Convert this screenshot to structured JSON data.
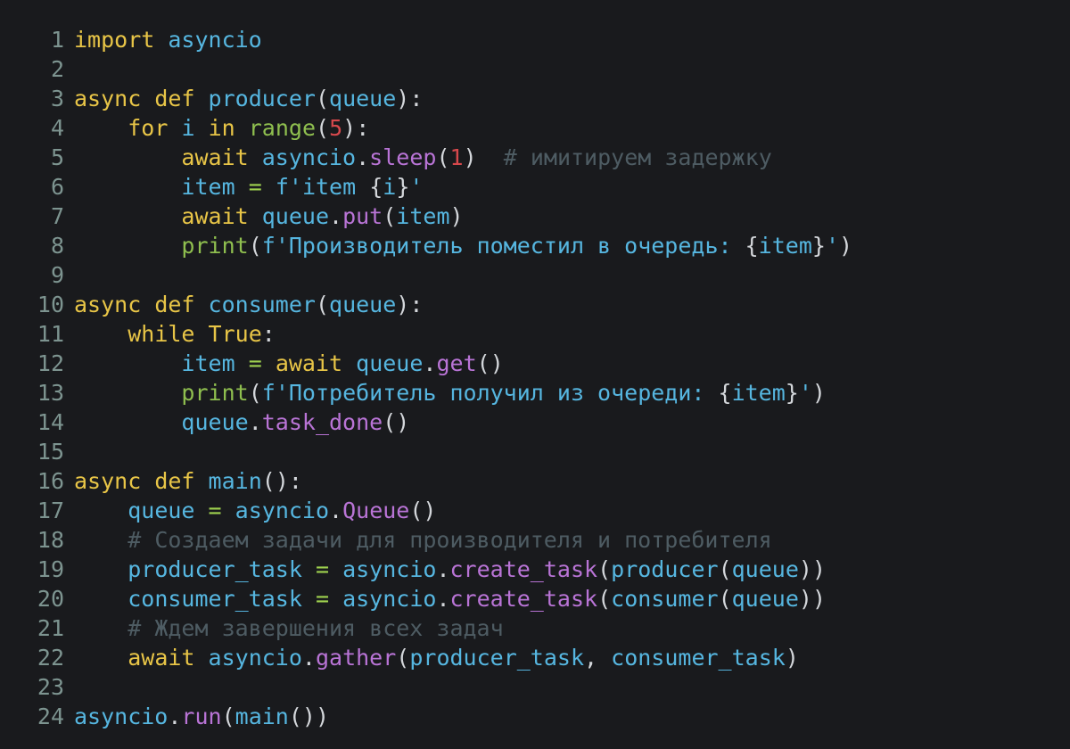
{
  "editor": {
    "language": "Python",
    "background_color": "#191a1d",
    "line_number_color": "#7d9490",
    "total_lines": 24,
    "theme_colors": {
      "keyword": "#e8c547",
      "builtin": "#8fbf4f",
      "number": "#d6484c",
      "name": "#56b6e0",
      "method": "#b974d6",
      "string": "#56b6e0",
      "comment": "#4e5c63",
      "operator": "#9fd14f",
      "punctuation": "#d4d7db"
    }
  },
  "lines": [
    {
      "number": "1",
      "text": "import asyncio",
      "tokens": [
        {
          "t": "import",
          "c": "keyword"
        },
        {
          "t": " ",
          "c": "plain"
        },
        {
          "t": "asyncio",
          "c": "name"
        }
      ]
    },
    {
      "number": "2",
      "text": "",
      "tokens": []
    },
    {
      "number": "3",
      "text": "async def producer(queue):",
      "tokens": [
        {
          "t": "async",
          "c": "keyword"
        },
        {
          "t": " ",
          "c": "plain"
        },
        {
          "t": "def",
          "c": "keyword"
        },
        {
          "t": " ",
          "c": "plain"
        },
        {
          "t": "producer",
          "c": "name"
        },
        {
          "t": "(",
          "c": "punct"
        },
        {
          "t": "queue",
          "c": "name"
        },
        {
          "t": ")",
          "c": "punct"
        },
        {
          "t": ":",
          "c": "punct"
        }
      ]
    },
    {
      "number": "4",
      "text": "    for i in range(5):",
      "tokens": [
        {
          "t": "    ",
          "c": "plain"
        },
        {
          "t": "for",
          "c": "keyword"
        },
        {
          "t": " ",
          "c": "plain"
        },
        {
          "t": "i",
          "c": "name"
        },
        {
          "t": " ",
          "c": "plain"
        },
        {
          "t": "in",
          "c": "keyword"
        },
        {
          "t": " ",
          "c": "plain"
        },
        {
          "t": "range",
          "c": "builtin"
        },
        {
          "t": "(",
          "c": "punct"
        },
        {
          "t": "5",
          "c": "number"
        },
        {
          "t": ")",
          "c": "punct"
        },
        {
          "t": ":",
          "c": "punct"
        }
      ]
    },
    {
      "number": "5",
      "text": "        await asyncio.sleep(1)  # имитируем задержку",
      "tokens": [
        {
          "t": "        ",
          "c": "plain"
        },
        {
          "t": "await",
          "c": "keyword"
        },
        {
          "t": " ",
          "c": "plain"
        },
        {
          "t": "asyncio",
          "c": "name"
        },
        {
          "t": ".",
          "c": "punct"
        },
        {
          "t": "sleep",
          "c": "method"
        },
        {
          "t": "(",
          "c": "punct"
        },
        {
          "t": "1",
          "c": "number"
        },
        {
          "t": ")",
          "c": "punct"
        },
        {
          "t": "  ",
          "c": "plain"
        },
        {
          "t": "# имитируем задержку",
          "c": "comment"
        }
      ]
    },
    {
      "number": "6",
      "text": "        item = f'item {i}'",
      "tokens": [
        {
          "t": "        ",
          "c": "plain"
        },
        {
          "t": "item",
          "c": "name"
        },
        {
          "t": " ",
          "c": "plain"
        },
        {
          "t": "=",
          "c": "operator"
        },
        {
          "t": " ",
          "c": "plain"
        },
        {
          "t": "f",
          "c": "fprefix"
        },
        {
          "t": "'item ",
          "c": "string"
        },
        {
          "t": "{",
          "c": "interp"
        },
        {
          "t": "i",
          "c": "string"
        },
        {
          "t": "}",
          "c": "interp"
        },
        {
          "t": "'",
          "c": "string"
        }
      ]
    },
    {
      "number": "7",
      "text": "        await queue.put(item)",
      "tokens": [
        {
          "t": "        ",
          "c": "plain"
        },
        {
          "t": "await",
          "c": "keyword"
        },
        {
          "t": " ",
          "c": "plain"
        },
        {
          "t": "queue",
          "c": "name"
        },
        {
          "t": ".",
          "c": "punct"
        },
        {
          "t": "put",
          "c": "method"
        },
        {
          "t": "(",
          "c": "punct"
        },
        {
          "t": "item",
          "c": "name"
        },
        {
          "t": ")",
          "c": "punct"
        }
      ]
    },
    {
      "number": "8",
      "text": "        print(f'Производитель поместил в очередь: {item}')",
      "tokens": [
        {
          "t": "        ",
          "c": "plain"
        },
        {
          "t": "print",
          "c": "builtin"
        },
        {
          "t": "(",
          "c": "punct"
        },
        {
          "t": "f",
          "c": "fprefix"
        },
        {
          "t": "'Производитель поместил в очередь: ",
          "c": "string"
        },
        {
          "t": "{",
          "c": "interp"
        },
        {
          "t": "item",
          "c": "string"
        },
        {
          "t": "}",
          "c": "interp"
        },
        {
          "t": "'",
          "c": "string"
        },
        {
          "t": ")",
          "c": "punct"
        }
      ]
    },
    {
      "number": "9",
      "text": "",
      "tokens": []
    },
    {
      "number": "10",
      "text": "async def consumer(queue):",
      "tokens": [
        {
          "t": "async",
          "c": "keyword"
        },
        {
          "t": " ",
          "c": "plain"
        },
        {
          "t": "def",
          "c": "keyword"
        },
        {
          "t": " ",
          "c": "plain"
        },
        {
          "t": "consumer",
          "c": "name"
        },
        {
          "t": "(",
          "c": "punct"
        },
        {
          "t": "queue",
          "c": "name"
        },
        {
          "t": ")",
          "c": "punct"
        },
        {
          "t": ":",
          "c": "punct"
        }
      ]
    },
    {
      "number": "11",
      "text": "    while True:",
      "tokens": [
        {
          "t": "    ",
          "c": "plain"
        },
        {
          "t": "while",
          "c": "keyword"
        },
        {
          "t": " ",
          "c": "plain"
        },
        {
          "t": "True",
          "c": "keyword"
        },
        {
          "t": ":",
          "c": "punct"
        }
      ]
    },
    {
      "number": "12",
      "text": "        item = await queue.get()",
      "tokens": [
        {
          "t": "        ",
          "c": "plain"
        },
        {
          "t": "item",
          "c": "name"
        },
        {
          "t": " ",
          "c": "plain"
        },
        {
          "t": "=",
          "c": "operator"
        },
        {
          "t": " ",
          "c": "plain"
        },
        {
          "t": "await",
          "c": "keyword"
        },
        {
          "t": " ",
          "c": "plain"
        },
        {
          "t": "queue",
          "c": "name"
        },
        {
          "t": ".",
          "c": "punct"
        },
        {
          "t": "get",
          "c": "method"
        },
        {
          "t": "()",
          "c": "punct"
        }
      ]
    },
    {
      "number": "13",
      "text": "        print(f'Потребитель получил из очереди: {item}')",
      "tokens": [
        {
          "t": "        ",
          "c": "plain"
        },
        {
          "t": "print",
          "c": "builtin"
        },
        {
          "t": "(",
          "c": "punct"
        },
        {
          "t": "f",
          "c": "fprefix"
        },
        {
          "t": "'Потребитель получил из очереди: ",
          "c": "string"
        },
        {
          "t": "{",
          "c": "interp"
        },
        {
          "t": "item",
          "c": "string"
        },
        {
          "t": "}",
          "c": "interp"
        },
        {
          "t": "'",
          "c": "string"
        },
        {
          "t": ")",
          "c": "punct"
        }
      ]
    },
    {
      "number": "14",
      "text": "        queue.task_done()",
      "tokens": [
        {
          "t": "        ",
          "c": "plain"
        },
        {
          "t": "queue",
          "c": "name"
        },
        {
          "t": ".",
          "c": "punct"
        },
        {
          "t": "task_done",
          "c": "method"
        },
        {
          "t": "()",
          "c": "punct"
        }
      ]
    },
    {
      "number": "15",
      "text": "",
      "tokens": []
    },
    {
      "number": "16",
      "text": "async def main():",
      "tokens": [
        {
          "t": "async",
          "c": "keyword"
        },
        {
          "t": " ",
          "c": "plain"
        },
        {
          "t": "def",
          "c": "keyword"
        },
        {
          "t": " ",
          "c": "plain"
        },
        {
          "t": "main",
          "c": "name"
        },
        {
          "t": "()",
          "c": "punct"
        },
        {
          "t": ":",
          "c": "punct"
        }
      ]
    },
    {
      "number": "17",
      "text": "    queue = asyncio.Queue()",
      "tokens": [
        {
          "t": "    ",
          "c": "plain"
        },
        {
          "t": "queue",
          "c": "name"
        },
        {
          "t": " ",
          "c": "plain"
        },
        {
          "t": "=",
          "c": "operator"
        },
        {
          "t": " ",
          "c": "plain"
        },
        {
          "t": "asyncio",
          "c": "name"
        },
        {
          "t": ".",
          "c": "punct"
        },
        {
          "t": "Queue",
          "c": "method"
        },
        {
          "t": "()",
          "c": "punct"
        }
      ]
    },
    {
      "number": "18",
      "text": "    # Создаем задачи для производителя и потребителя",
      "tokens": [
        {
          "t": "    ",
          "c": "plain"
        },
        {
          "t": "# Создаем задачи для производителя и потребителя",
          "c": "comment"
        }
      ]
    },
    {
      "number": "19",
      "text": "    producer_task = asyncio.create_task(producer(queue))",
      "tokens": [
        {
          "t": "    ",
          "c": "plain"
        },
        {
          "t": "producer_task",
          "c": "name"
        },
        {
          "t": " ",
          "c": "plain"
        },
        {
          "t": "=",
          "c": "operator"
        },
        {
          "t": " ",
          "c": "plain"
        },
        {
          "t": "asyncio",
          "c": "name"
        },
        {
          "t": ".",
          "c": "punct"
        },
        {
          "t": "create_task",
          "c": "method"
        },
        {
          "t": "(",
          "c": "punct"
        },
        {
          "t": "producer",
          "c": "name"
        },
        {
          "t": "(",
          "c": "punct"
        },
        {
          "t": "queue",
          "c": "name"
        },
        {
          "t": "))",
          "c": "punct"
        }
      ]
    },
    {
      "number": "20",
      "text": "    consumer_task = asyncio.create_task(consumer(queue))",
      "tokens": [
        {
          "t": "    ",
          "c": "plain"
        },
        {
          "t": "consumer_task",
          "c": "name"
        },
        {
          "t": " ",
          "c": "plain"
        },
        {
          "t": "=",
          "c": "operator"
        },
        {
          "t": " ",
          "c": "plain"
        },
        {
          "t": "asyncio",
          "c": "name"
        },
        {
          "t": ".",
          "c": "punct"
        },
        {
          "t": "create_task",
          "c": "method"
        },
        {
          "t": "(",
          "c": "punct"
        },
        {
          "t": "consumer",
          "c": "name"
        },
        {
          "t": "(",
          "c": "punct"
        },
        {
          "t": "queue",
          "c": "name"
        },
        {
          "t": "))",
          "c": "punct"
        }
      ]
    },
    {
      "number": "21",
      "text": "    # Ждем завершения всех задач",
      "tokens": [
        {
          "t": "    ",
          "c": "plain"
        },
        {
          "t": "# Ждем завершения всех задач",
          "c": "comment"
        }
      ]
    },
    {
      "number": "22",
      "text": "    await asyncio.gather(producer_task, consumer_task)",
      "tokens": [
        {
          "t": "    ",
          "c": "plain"
        },
        {
          "t": "await",
          "c": "keyword"
        },
        {
          "t": " ",
          "c": "plain"
        },
        {
          "t": "asyncio",
          "c": "name"
        },
        {
          "t": ".",
          "c": "punct"
        },
        {
          "t": "gather",
          "c": "method"
        },
        {
          "t": "(",
          "c": "punct"
        },
        {
          "t": "producer_task",
          "c": "name"
        },
        {
          "t": ",",
          "c": "punct"
        },
        {
          "t": " ",
          "c": "plain"
        },
        {
          "t": "consumer_task",
          "c": "name"
        },
        {
          "t": ")",
          "c": "punct"
        }
      ]
    },
    {
      "number": "23",
      "text": "",
      "tokens": []
    },
    {
      "number": "24",
      "text": "asyncio.run(main())",
      "tokens": [
        {
          "t": "asyncio",
          "c": "name"
        },
        {
          "t": ".",
          "c": "punct"
        },
        {
          "t": "run",
          "c": "method"
        },
        {
          "t": "(",
          "c": "punct"
        },
        {
          "t": "main",
          "c": "name"
        },
        {
          "t": "())",
          "c": "punct"
        }
      ]
    }
  ]
}
